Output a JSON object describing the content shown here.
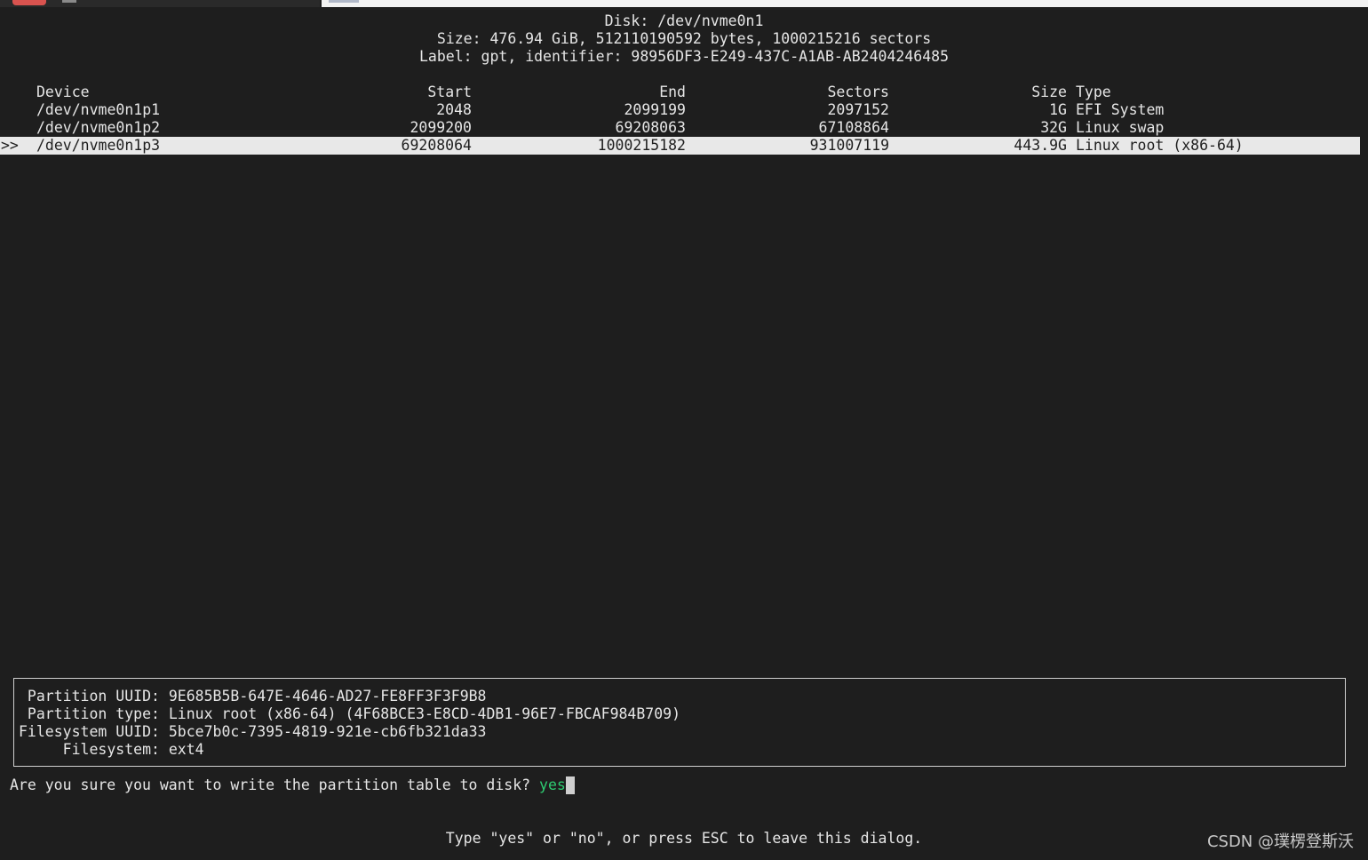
{
  "disk": {
    "header": "Disk: /dev/nvme0n1",
    "size_line": "Size: 476.94 GiB, 512110190592 bytes, 1000215216 sectors",
    "label_line": "Label: gpt, identifier: 98956DF3-E249-437C-A1AB-AB2404246485"
  },
  "table": {
    "headers": {
      "device": "Device",
      "start": "Start",
      "end": "End",
      "sectors": "Sectors",
      "size": "Size",
      "type": "Type"
    },
    "rows": [
      {
        "device": "/dev/nvme0n1p1",
        "start": "2048",
        "end": "2099199",
        "sectors": "2097152",
        "size": "1G",
        "type": "EFI System"
      },
      {
        "device": "/dev/nvme0n1p2",
        "start": "2099200",
        "end": "69208063",
        "sectors": "67108864",
        "size": "32G",
        "type": "Linux swap"
      },
      {
        "device": "/dev/nvme0n1p3",
        "start": "69208064",
        "end": "1000215182",
        "sectors": "931007119",
        "size": "443.9G",
        "type": "Linux root (x86-64)",
        "marker": ">>"
      }
    ]
  },
  "info": {
    "partition_uuid": " Partition UUID: 9E685B5B-647E-4646-AD27-FE8FF3F3F9B8",
    "partition_type": " Partition type: Linux root (x86-64) (4F68BCE3-E8CD-4DB1-96E7-FBCAF984B709)",
    "filesystem_uuid": "Filesystem UUID: 5bce7b0c-7395-4819-921e-cb6fb321da33",
    "filesystem": "     Filesystem: ext4"
  },
  "prompt": {
    "question": "Are you sure you want to write the partition table to disk? ",
    "answer": "yes",
    "hint": "Type \"yes\" or \"no\", or press ESC to leave this dialog."
  },
  "watermark": "CSDN @璞楞登斯沃",
  "colors": {
    "background": "#1e1e1e",
    "text": "#e6e6e6",
    "selected_row": "#e8e8e8",
    "answer": "#2ecc71"
  }
}
